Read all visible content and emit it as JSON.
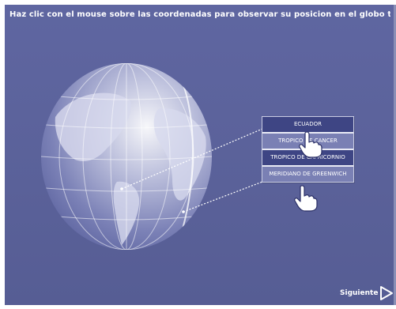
{
  "instruction": "Haz clic con el mouse sobre las coordenadas para observar su posicion en el globo terraqueo.",
  "menu": {
    "items": [
      {
        "label": "ECUADOR"
      },
      {
        "label": "TROPICO DE CANCER"
      },
      {
        "label": "TROPICO DE CAPRICORNIO"
      },
      {
        "label": "MERIDIANO DE GREENWICH"
      }
    ]
  },
  "next": {
    "label": "Siguiente"
  },
  "colors": {
    "background": "#5f66a1",
    "menu_dark": "#3e4584",
    "menu_mid": "#7a80b4"
  },
  "icons": [
    "globe-icon",
    "hand-cursor-icon",
    "play-arrow-icon"
  ]
}
